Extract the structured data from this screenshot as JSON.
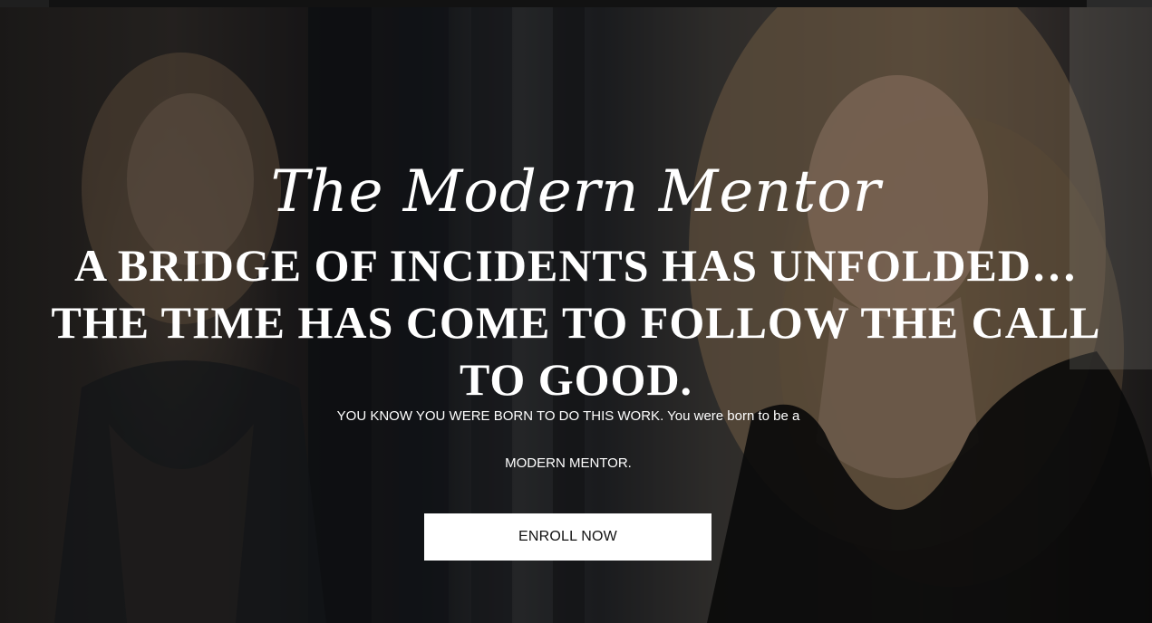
{
  "hero": {
    "script_title": "The Modern Mentor",
    "headline": "A Bridge of Incidents has unfolded…the time has come to follow the call to good.",
    "subtext_line1": "YOU KNOW YOU WERE BORN TO DO THIS WORK. You were born to be a",
    "subtext_line2": "MODERN MENTOR.",
    "cta_label": "ENROLL NOW"
  },
  "colors": {
    "overlay": "#000000",
    "text": "#ffffff",
    "button_bg": "#ffffff",
    "button_text": "#111111"
  }
}
